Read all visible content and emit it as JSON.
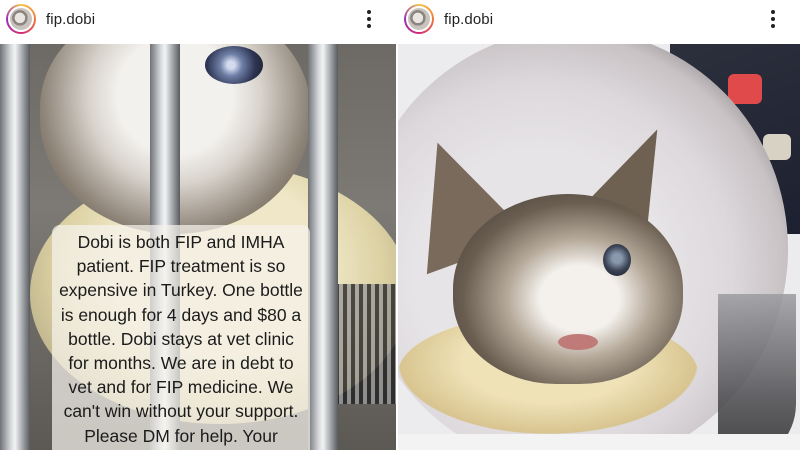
{
  "posts": [
    {
      "username": "fip.dobi",
      "caption": "Dobi is both FIP and IMHA patient. FIP treatment is so expensive in Turkey. One bottle is enough for 4 days and $80 a bottle. Dobi stays at vet clinic for months. We are in debt to vet and for FIP medicine. We can't win without your support. Please DM for help. Your support is"
    },
    {
      "username": "fip.dobi"
    }
  ],
  "icons": {
    "more": "more-options-vertical-icon",
    "avatar": "profile-avatar"
  },
  "colors": {
    "avatar_ring_start": "#f6c64d",
    "avatar_ring_end": "#962fbf",
    "text": "#222222"
  }
}
